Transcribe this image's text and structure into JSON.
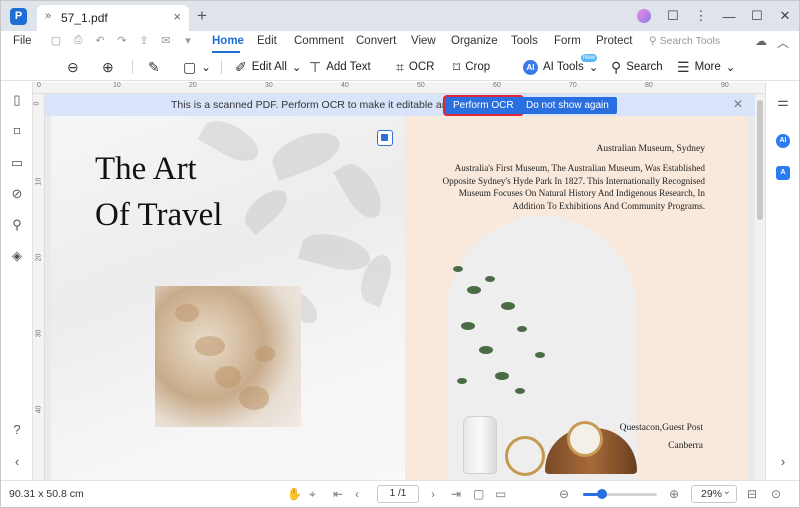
{
  "titlebar": {
    "tab_title": "57_1.pdf",
    "icons": {
      "logo": "pdfelement-logo-icon",
      "tab": "chevrons-down-icon",
      "close": "close-icon",
      "new_tab": "plus-icon"
    }
  },
  "menu": {
    "file": "File",
    "items": [
      "Home",
      "Edit",
      "Comment",
      "Convert",
      "View",
      "Organize",
      "Tools",
      "Form",
      "Protect"
    ],
    "active": "Home",
    "search_tools": "Search Tools"
  },
  "toolbar": {
    "edit_all": "Edit All",
    "add_text": "Add Text",
    "ocr": "OCR",
    "crop": "Crop",
    "ai_tools": "AI Tools",
    "ai_badge": "AI",
    "new_badge": "New",
    "search": "Search",
    "more": "More"
  },
  "ruler": {
    "top": [
      "0",
      "10",
      "20",
      "30",
      "40",
      "50",
      "60",
      "70",
      "80",
      "90"
    ],
    "left": [
      "0",
      "10",
      "20",
      "30",
      "40"
    ]
  },
  "ocr_banner": {
    "message": "This is a scanned PDF. Perform OCR to make it editable and searchable.",
    "perform_label": "Perform OCR",
    "dismiss_label": "Do not show again"
  },
  "document": {
    "title_line1": "The Art",
    "title_line2": "Of Travel",
    "museum_name": "Australian Museum, Sydney",
    "museum_text": "Australia's First Museum, The Australian Museum, Was Established Opposite Sydney's Hyde Park In 1827. This Internationally Recognised Museum Focuses On Natural History And Indigenous Research, In Addition To Exhibitions And Community Programs.",
    "guest_post": "Questacon,Guest Post",
    "city": "Canberra"
  },
  "right_sidebar": {
    "ai_label": "AI",
    "translate_label": "A"
  },
  "statusbar": {
    "dimensions": "90.31 x 50.8 cm",
    "page_current": "1",
    "page_total": "/1",
    "page_display": "1 /1",
    "zoom": "29%",
    "zoom_slider_fraction": 0.25
  },
  "colors": {
    "accent": "#1f6ed4",
    "banner": "#d9e4fb",
    "highlight": "#e0253c"
  }
}
